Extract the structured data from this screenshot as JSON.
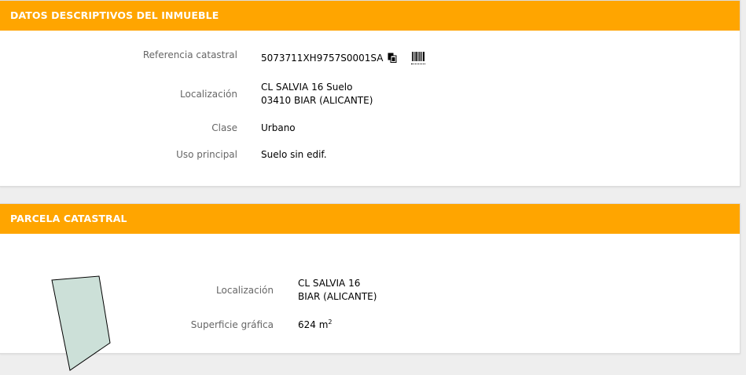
{
  "inmueble": {
    "header": "DATOS DESCRIPTIVOS DEL INMUEBLE",
    "referencia_label": "Referencia catastral",
    "referencia_value": "5073711XH9757S0001SA",
    "localizacion_label": "Localización",
    "localizacion_line1": "CL SALVIA 16 Suelo",
    "localizacion_line2": "03410 BIAR (ALICANTE)",
    "clase_label": "Clase",
    "clase_value": "Urbano",
    "uso_label": "Uso principal",
    "uso_value": "Suelo sin edif."
  },
  "parcela": {
    "header": "PARCELA CATASTRAL",
    "localizacion_label": "Localización",
    "localizacion_line1": "CL SALVIA 16",
    "localizacion_line2": "BIAR (ALICANTE)",
    "superficie_label": "Superficie gráfica",
    "superficie_value": "624 m",
    "superficie_unit_exp": "2"
  },
  "icons": {
    "copy": "copy-icon",
    "barcode": "barcode-icon"
  },
  "colors": {
    "header_bg": "#ffa500",
    "header_text": "#ffffff",
    "label_text": "#666666",
    "parcel_fill": "#cce0d8"
  }
}
